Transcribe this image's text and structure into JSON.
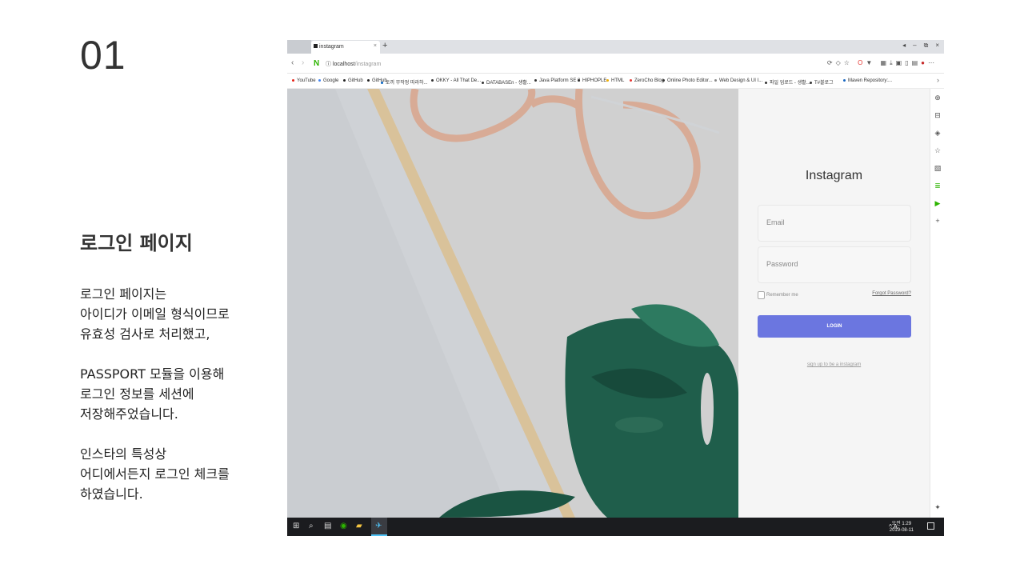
{
  "slide": {
    "number": "01",
    "title": "로그인 페이지",
    "desc1": [
      "로그인 페이지는",
      "아이디가 이메일 형식이므로",
      "유효성 검사로 처리했고,"
    ],
    "desc2": [
      "PASSPORT 모듈을 이용해",
      "로그인 정보를 세션에",
      "저장해주었습니다."
    ],
    "desc3": [
      "인스타의 특성상",
      "어디에서든지 로그인 체크를",
      "하였습니다."
    ]
  },
  "browser": {
    "tab_title": "instagram",
    "tab_close": "×",
    "new_tab": "+",
    "address_host": "localhost",
    "address_path": "/instagram",
    "bookmarks": [
      {
        "label": "YouTube",
        "color": "#e62117"
      },
      {
        "label": "Google",
        "color": "#4285f4"
      },
      {
        "label": "GitHub",
        "color": "#222222"
      },
      {
        "label": "GitHub",
        "color": "#222222"
      },
      {
        "label": "토끼 무작정 따라하...",
        "color": "#0a66c2"
      },
      {
        "label": "OKKY - All That De...",
        "color": "#333333"
      },
      {
        "label": "DATABASEn - 생활...",
        "color": "#333333"
      },
      {
        "label": "Java Platform SE 8",
        "color": "#333333"
      },
      {
        "label": "HIPHOPLE",
        "color": "#333333"
      },
      {
        "label": "HTML",
        "color": "#f0ad00"
      },
      {
        "label": "ZeroCho Blog",
        "color": "#e53935"
      },
      {
        "label": "Online Photo Editor...",
        "color": "#333333"
      },
      {
        "label": "Web Design & UI I...",
        "color": "#888888"
      },
      {
        "label": "파일 업로드 - 생활...",
        "color": "#333333"
      },
      {
        "label": "T#블로그",
        "color": "#333333"
      },
      {
        "label": "Maven Repository:...",
        "color": "#1565c0"
      }
    ]
  },
  "login": {
    "title": "Instagram",
    "email_placeholder": "Email",
    "password_placeholder": "Password",
    "remember_label": "Remember me",
    "forgot_label": "Forgot Password?",
    "login_button": "LOGIN",
    "signup_link": "sign up to be a instagram",
    "button_color": "#6b76e0"
  },
  "taskbar": {
    "ime": "A",
    "time_period": "오전 1:29",
    "date": "2019-08-11"
  }
}
